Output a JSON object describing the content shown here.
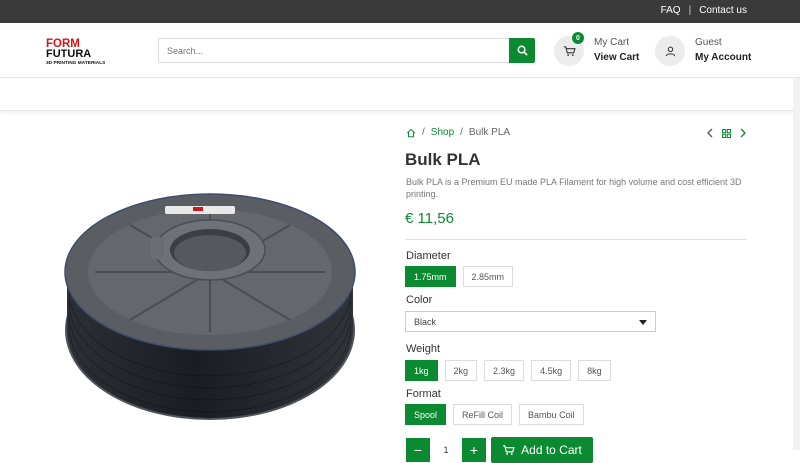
{
  "topbar": {
    "faq": "FAQ",
    "separator": "|",
    "contact": "Contact us"
  },
  "logo": {
    "line1": "FORM",
    "line2": "FUTURA",
    "tagline": "3D PRINTING MATERIALS"
  },
  "search": {
    "placeholder": "Search..."
  },
  "cart": {
    "count": "0",
    "label_small": "My Cart",
    "label_big": "View Cart"
  },
  "account": {
    "label_small": "Guest",
    "label_big": "My Account"
  },
  "breadcrumb": {
    "sep1": "/",
    "shop": "Shop",
    "sep2": "/",
    "current": "Bulk PLA"
  },
  "product": {
    "title": "Bulk PLA",
    "description": "Bulk PLA is a Premium EU made PLA Filament for high volume and cost efficient 3D printing.",
    "price": "€ 11,56"
  },
  "diameter": {
    "label": "Diameter",
    "options": [
      "1.75mm",
      "2.85mm"
    ],
    "selected": "1.75mm"
  },
  "color": {
    "label": "Color",
    "selected": "Black"
  },
  "weight": {
    "label": "Weight",
    "options": [
      "1kg",
      "2kg",
      "2.3kg",
      "4.5kg",
      "8kg"
    ],
    "selected": "1kg"
  },
  "format": {
    "label": "Format",
    "options": [
      "Spool",
      "ReFill Coil",
      "Bambu Coil"
    ],
    "selected": "Spool"
  },
  "quantity": {
    "minus": "−",
    "value": "1",
    "plus": "+"
  },
  "add_to_cart": "Add to Cart",
  "colors": {
    "accent": "#0b8a32",
    "topbar": "#3a3a3a",
    "logo_red": "#d4151b"
  }
}
